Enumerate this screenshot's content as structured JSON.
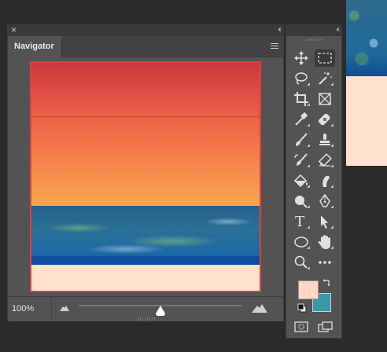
{
  "navigator": {
    "tab_label": "Navigator",
    "zoom_value": "100%",
    "zoom_slider_fraction": 0.5
  },
  "icons": {
    "close": "×",
    "collapse": "‹‹",
    "text_tool": "T"
  },
  "colors": {
    "foreground": "#ffd7c2",
    "background": "#3b98a6",
    "view_box": "#e04040"
  },
  "tools": [
    {
      "name": "move-tool-icon"
    },
    {
      "name": "rectangular-marquee-tool-icon",
      "active": true
    },
    {
      "name": "lasso-tool-icon"
    },
    {
      "name": "magic-wand-tool-icon"
    },
    {
      "name": "crop-tool-icon"
    },
    {
      "name": "frame-tool-icon"
    },
    {
      "name": "eyedropper-tool-icon"
    },
    {
      "name": "healing-brush-tool-icon"
    },
    {
      "name": "brush-tool-icon"
    },
    {
      "name": "clone-stamp-tool-icon"
    },
    {
      "name": "history-brush-tool-icon"
    },
    {
      "name": "eraser-tool-icon"
    },
    {
      "name": "paint-bucket-tool-icon"
    },
    {
      "name": "smudge-tool-icon"
    },
    {
      "name": "dodge-tool-icon"
    },
    {
      "name": "pen-tool-icon"
    },
    {
      "name": "type-tool-icon"
    },
    {
      "name": "path-selection-tool-icon"
    },
    {
      "name": "ellipse-tool-icon"
    },
    {
      "name": "hand-tool-icon"
    },
    {
      "name": "zoom-tool-icon"
    },
    {
      "name": "edit-toolbar-icon"
    }
  ]
}
